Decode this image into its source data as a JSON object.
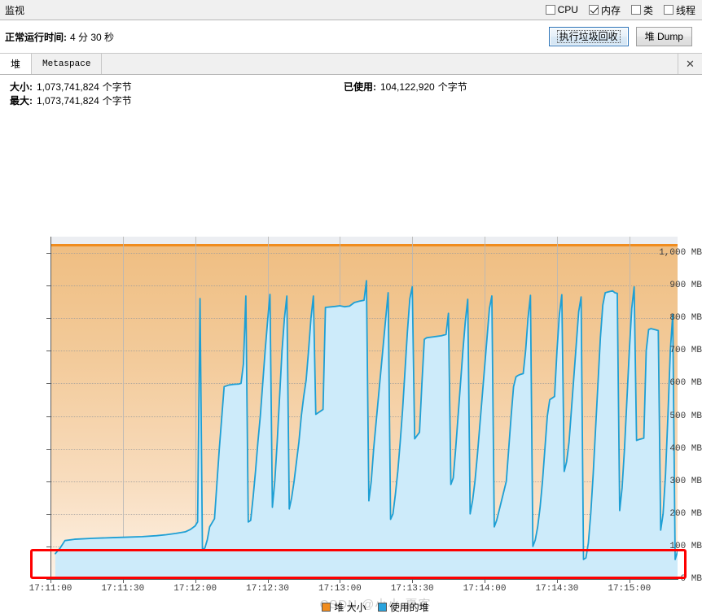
{
  "window": {
    "title": "监视"
  },
  "toggles": [
    {
      "label": "CPU",
      "checked": false
    },
    {
      "label": "内存",
      "checked": true
    },
    {
      "label": "类",
      "checked": false
    },
    {
      "label": "线程",
      "checked": false
    }
  ],
  "uptime": {
    "label": "正常运行时间:",
    "value": "4 分 30 秒"
  },
  "toolbar": {
    "gc_label": "执行垃圾回收",
    "heapdump_label": "堆 Dump"
  },
  "tabs": [
    {
      "label": "堆",
      "active": true
    },
    {
      "label": "Metaspace",
      "active": false
    }
  ],
  "tab_close_icon": "✕",
  "stats": {
    "size_key": "大小:",
    "size_value": "1,073,741,824",
    "size_unit": "个字节",
    "max_key": "最大:",
    "max_value": "1,073,741,824",
    "max_unit": "个字节",
    "used_key": "已使用:",
    "used_value": "104,122,920",
    "used_unit": "个字节"
  },
  "legend": [
    {
      "label": "堆 大小",
      "color": "#f08c1e"
    },
    {
      "label": "使用的堆",
      "color": "#29a3dd"
    }
  ],
  "watermark": "CSDN @小小 夏客",
  "colors": {
    "heap_size_line": "#f08c1e",
    "used_heap_line": "#1e9fd4",
    "used_heap_fill": "#cdebfa",
    "annotation": "#fe0000",
    "plot_background": "#eceef2"
  },
  "chart_data": {
    "type": "area",
    "title": "",
    "xlabel": "",
    "ylabel": "",
    "ylim": [
      0,
      1050
    ],
    "yunit": "MB",
    "grid": true,
    "legend_position": "bottom",
    "ytick_labels": [
      "0 MB",
      "100 MB",
      "200 MB",
      "300 MB",
      "400 MB",
      "500 MB",
      "600 MB",
      "700 MB",
      "800 MB",
      "900 MB",
      "1,000 MB"
    ],
    "ytick_values": [
      0,
      100,
      200,
      300,
      400,
      500,
      600,
      700,
      800,
      900,
      1000
    ],
    "xtick_labels": [
      "17:11:00",
      "17:11:30",
      "17:12:00",
      "17:12:30",
      "17:13:00",
      "17:13:30",
      "17:14:00",
      "17:14:30",
      "17:15:00"
    ],
    "xlim_seconds": [
      60,
      320
    ],
    "series": [
      {
        "name": "堆 大小",
        "color": "#f08c1e",
        "constant": 1024,
        "points": [
          [
            60,
            1024
          ],
          [
            320,
            1024
          ]
        ]
      },
      {
        "name": "使用的堆",
        "color": "#1e9fd4",
        "points": [
          [
            62,
            78
          ],
          [
            64,
            95
          ],
          [
            66,
            118
          ],
          [
            70,
            122
          ],
          [
            78,
            125
          ],
          [
            86,
            127
          ],
          [
            90,
            128
          ],
          [
            98,
            130
          ],
          [
            104,
            133
          ],
          [
            108,
            136
          ],
          [
            112,
            140
          ],
          [
            116,
            145
          ],
          [
            118,
            152
          ],
          [
            120,
            163
          ],
          [
            121,
            175
          ],
          [
            122,
            860
          ],
          [
            123,
            90
          ],
          [
            124,
            95
          ],
          [
            125,
            120
          ],
          [
            126,
            160
          ],
          [
            128,
            185
          ],
          [
            130,
            400
          ],
          [
            132,
            590
          ],
          [
            134,
            595
          ],
          [
            136,
            597
          ],
          [
            138,
            598
          ],
          [
            139,
            600
          ],
          [
            140,
            660
          ],
          [
            141,
            868
          ],
          [
            142,
            175
          ],
          [
            143,
            180
          ],
          [
            144,
            250
          ],
          [
            145,
            330
          ],
          [
            146,
            420
          ],
          [
            147,
            500
          ],
          [
            148,
            600
          ],
          [
            149,
            700
          ],
          [
            150,
            790
          ],
          [
            151,
            873
          ],
          [
            152,
            220
          ],
          [
            153,
            300
          ],
          [
            154,
            420
          ],
          [
            155,
            560
          ],
          [
            156,
            700
          ],
          [
            157,
            800
          ],
          [
            158,
            868
          ],
          [
            159,
            215
          ],
          [
            160,
            250
          ],
          [
            161,
            300
          ],
          [
            162,
            360
          ],
          [
            163,
            420
          ],
          [
            164,
            500
          ],
          [
            165,
            560
          ],
          [
            166,
            610
          ],
          [
            167,
            700
          ],
          [
            168,
            800
          ],
          [
            169,
            868
          ],
          [
            170,
            505
          ],
          [
            171,
            510
          ],
          [
            172,
            515
          ],
          [
            173,
            520
          ],
          [
            174,
            833
          ],
          [
            178,
            836
          ],
          [
            180,
            838
          ],
          [
            182,
            835
          ],
          [
            184,
            837
          ],
          [
            186,
            848
          ],
          [
            188,
            852
          ],
          [
            190,
            855
          ],
          [
            191,
            915
          ],
          [
            192,
            240
          ],
          [
            193,
            300
          ],
          [
            194,
            400
          ],
          [
            195,
            480
          ],
          [
            196,
            560
          ],
          [
            197,
            640
          ],
          [
            198,
            720
          ],
          [
            199,
            800
          ],
          [
            200,
            878
          ],
          [
            201,
            183
          ],
          [
            202,
            200
          ],
          [
            203,
            260
          ],
          [
            204,
            330
          ],
          [
            205,
            420
          ],
          [
            206,
            520
          ],
          [
            207,
            640
          ],
          [
            208,
            760
          ],
          [
            209,
            860
          ],
          [
            210,
            896
          ],
          [
            211,
            430
          ],
          [
            212,
            440
          ],
          [
            213,
            450
          ],
          [
            214,
            600
          ],
          [
            215,
            735
          ],
          [
            216,
            740
          ],
          [
            218,
            742
          ],
          [
            220,
            744
          ],
          [
            222,
            746
          ],
          [
            224,
            750
          ],
          [
            225,
            815
          ],
          [
            226,
            290
          ],
          [
            227,
            310
          ],
          [
            228,
            400
          ],
          [
            229,
            500
          ],
          [
            230,
            600
          ],
          [
            231,
            700
          ],
          [
            232,
            790
          ],
          [
            233,
            858
          ],
          [
            234,
            200
          ],
          [
            235,
            240
          ],
          [
            236,
            300
          ],
          [
            237,
            380
          ],
          [
            238,
            470
          ],
          [
            239,
            560
          ],
          [
            240,
            650
          ],
          [
            241,
            740
          ],
          [
            242,
            830
          ],
          [
            243,
            868
          ],
          [
            244,
            160
          ],
          [
            245,
            180
          ],
          [
            246,
            210
          ],
          [
            247,
            240
          ],
          [
            248,
            270
          ],
          [
            249,
            300
          ],
          [
            250,
            400
          ],
          [
            251,
            500
          ],
          [
            252,
            590
          ],
          [
            253,
            620
          ],
          [
            254,
            625
          ],
          [
            255,
            628
          ],
          [
            256,
            630
          ],
          [
            257,
            700
          ],
          [
            258,
            800
          ],
          [
            259,
            870
          ],
          [
            260,
            100
          ],
          [
            261,
            120
          ],
          [
            262,
            160
          ],
          [
            263,
            220
          ],
          [
            264,
            300
          ],
          [
            265,
            400
          ],
          [
            266,
            500
          ],
          [
            267,
            550
          ],
          [
            268,
            555
          ],
          [
            269,
            560
          ],
          [
            270,
            700
          ],
          [
            271,
            810
          ],
          [
            272,
            872
          ],
          [
            273,
            330
          ],
          [
            274,
            360
          ],
          [
            275,
            420
          ],
          [
            276,
            520
          ],
          [
            277,
            620
          ],
          [
            278,
            720
          ],
          [
            279,
            820
          ],
          [
            280,
            865
          ],
          [
            281,
            60
          ],
          [
            282,
            65
          ],
          [
            283,
            110
          ],
          [
            284,
            200
          ],
          [
            285,
            320
          ],
          [
            286,
            460
          ],
          [
            287,
            600
          ],
          [
            288,
            740
          ],
          [
            289,
            840
          ],
          [
            290,
            878
          ],
          [
            291,
            880
          ],
          [
            292,
            882
          ],
          [
            293,
            884
          ],
          [
            294,
            878
          ],
          [
            295,
            876
          ],
          [
            296,
            210
          ],
          [
            297,
            280
          ],
          [
            298,
            400
          ],
          [
            299,
            550
          ],
          [
            300,
            700
          ],
          [
            301,
            830
          ],
          [
            302,
            896
          ],
          [
            303,
            425
          ],
          [
            304,
            428
          ],
          [
            305,
            430
          ],
          [
            306,
            432
          ],
          [
            307,
            700
          ],
          [
            308,
            765
          ],
          [
            309,
            768
          ],
          [
            310,
            766
          ],
          [
            311,
            764
          ],
          [
            312,
            762
          ],
          [
            313,
            150
          ],
          [
            314,
            200
          ],
          [
            315,
            320
          ],
          [
            316,
            500
          ],
          [
            317,
            700
          ],
          [
            318,
            812
          ],
          [
            319,
            60
          ],
          [
            320,
            85
          ],
          [
            321,
            95
          ],
          [
            322,
            100
          ]
        ]
      }
    ]
  }
}
